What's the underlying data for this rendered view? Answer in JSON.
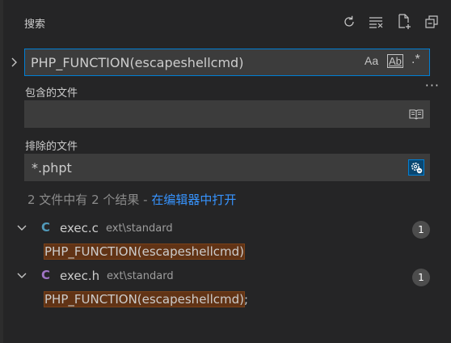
{
  "header": {
    "title": "搜索",
    "actions": [
      "refresh-icon",
      "clear-results-icon",
      "new-search-editor-icon",
      "collapse-all-icon"
    ]
  },
  "search": {
    "query": "PHP_FUNCTION(escapeshellcmd)",
    "options": {
      "match_case": "Aa",
      "whole_word": "Ab",
      "regex": ".*"
    }
  },
  "more_label": "···",
  "include": {
    "label": "包含的文件",
    "value": ""
  },
  "exclude": {
    "label": "排除的文件",
    "value": "*.phpt"
  },
  "summary": {
    "text": "2 文件中有 2 个结果 - ",
    "link": "在编辑器中打开"
  },
  "results": [
    {
      "icon": "C",
      "icon_color": "#519aba",
      "file": "exec.c",
      "path": "ext\\standard",
      "count": "1",
      "match_pre": "",
      "match_hl": "PHP_FUNCTION(escapeshellcmd)",
      "match_post": ""
    },
    {
      "icon": "C",
      "icon_color": "#a074c4",
      "file": "exec.h",
      "path": "ext\\standard",
      "count": "1",
      "match_pre": "",
      "match_hl": "PHP_FUNCTION(escapeshellcmd)",
      "match_post": ";"
    }
  ],
  "colors": {
    "background": "#252526",
    "input_bg": "#3c3c3c",
    "focus_border": "#007fd4",
    "link": "#3794ff",
    "match_highlight": "#613315"
  }
}
